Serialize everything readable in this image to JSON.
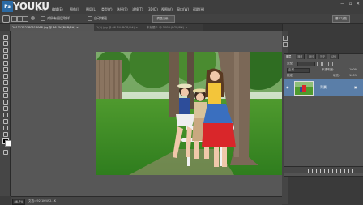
{
  "watermark": "YOUKU",
  "menu": [
    "文件(F)",
    "编辑(E)",
    "图像(I)",
    "图层(L)",
    "类型(Y)",
    "选择(S)",
    "滤镜(T)",
    "3D(D)",
    "视图(V)",
    "窗口(W)",
    "帮助(H)"
  ],
  "options": {
    "sample_all": "对所有图层取样",
    "auto_enhance": "自动增强",
    "refine_edge": "调整边缘...",
    "workspace": "基本功能"
  },
  "tabs": [
    {
      "label": "20131222180518068.jpg @ 86.7%(RGB/8#) ×",
      "active": true
    },
    {
      "label": "1(2).jpg @ 66.7%(RGB/8#) ×",
      "active": false
    },
    {
      "label": "未标题-1 @ 100%(RGB/8#) ×",
      "active": false
    }
  ],
  "panels": {
    "tabs": [
      "图层",
      "通道",
      "路径",
      "历史",
      "动作"
    ],
    "kind_label": "类型",
    "blend_mode": "正常",
    "opacity_label": "不透明度:",
    "opacity_value": "100%",
    "lock_label": "锁定:",
    "fill_label": "填充:",
    "fill_value": "100%",
    "layer_name": "背景"
  },
  "status": {
    "zoom": "86.7%",
    "doc": "文档:492.1K/492.1K"
  },
  "colors": {
    "accent": "#5a7ea8",
    "foreground": "#000000",
    "background": "#ffffff"
  }
}
